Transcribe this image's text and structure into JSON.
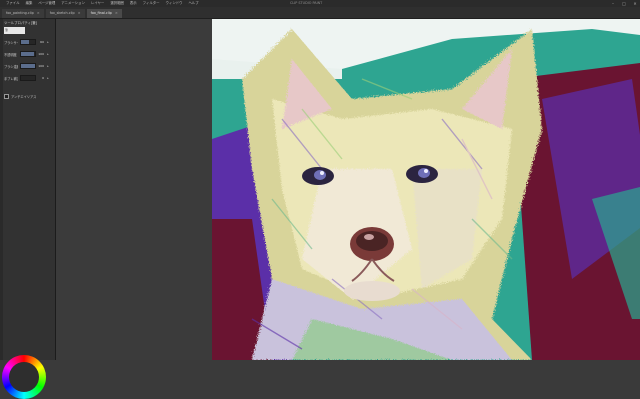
{
  "menubar": {
    "items": [
      "ファイル",
      "編集",
      "ページ管理",
      "アニメーション",
      "レイヤー",
      "選択範囲",
      "表示",
      "フィルター",
      "ウィンドウ",
      "ヘルプ"
    ],
    "app_title": "CLIP STUDIO PAINT",
    "window_controls": [
      "minimize",
      "maximize",
      "close"
    ]
  },
  "tabs": [
    {
      "label": "fox_painting.clip",
      "active": false
    },
    {
      "label": "fox_sketch.clip",
      "active": false
    },
    {
      "label": "fox_final.clip",
      "active": true
    }
  ],
  "tool_property": {
    "header": "ツールプロパティ[筆]",
    "preview_label": "筆",
    "rows": [
      {
        "label": "ブラシサイズ",
        "value": "60",
        "fill": 0.55
      },
      {
        "label": "不透明度",
        "value": "100",
        "fill": 0.9
      },
      {
        "label": "ブラシ濃度",
        "value": "100",
        "fill": 1.0
      },
      {
        "label": "手ブレ補正",
        "value": "0",
        "fill": 0.0
      }
    ],
    "checkbox_label": "アンチエイリアス"
  },
  "colors": {
    "canvas_bg": "#3b3b3b",
    "panel_bg": "#323232",
    "teal": "#2aa890",
    "purple": "#5b2fa8",
    "maroon": "#6b1230",
    "cream": "#ece7b8"
  },
  "icons": {
    "close": "close-icon",
    "minimize": "minimize-icon",
    "maximize": "maximize-icon",
    "color_wheel": "color-wheel-icon"
  }
}
